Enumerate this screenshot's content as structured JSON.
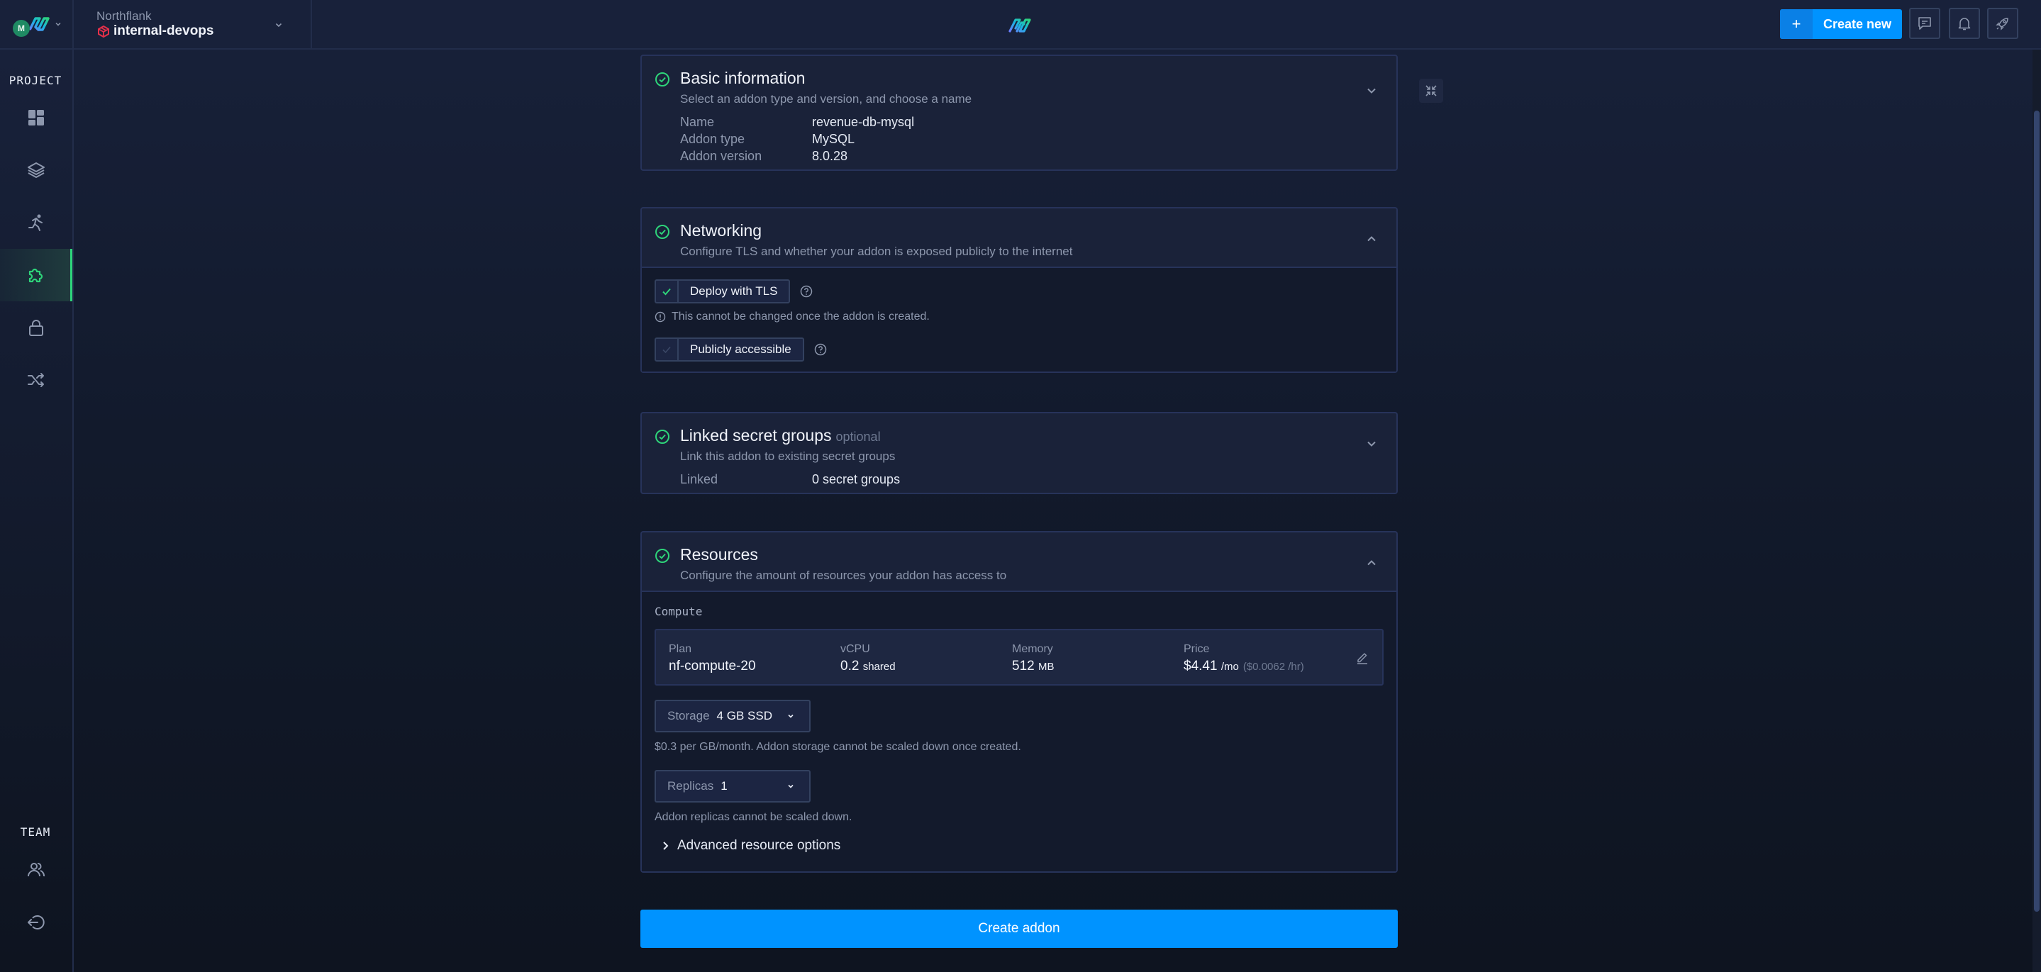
{
  "topbar": {
    "avatar_initial": "M",
    "org_name": "Northflank",
    "project_name": "internal-devops",
    "create_new_plus": "+",
    "create_new_label": "Create new",
    "icons": [
      "chat-icon",
      "bell-icon",
      "rocket-icon"
    ]
  },
  "sidebar": {
    "project_heading": "PROJECT",
    "team_heading": "TEAM",
    "project_items": [
      {
        "name": "dashboard",
        "icon": "grid-icon",
        "active": false
      },
      {
        "name": "services",
        "icon": "layers-icon",
        "active": false
      },
      {
        "name": "jobs",
        "icon": "running-icon",
        "active": false
      },
      {
        "name": "addons",
        "icon": "puzzle-icon",
        "active": true
      },
      {
        "name": "secrets",
        "icon": "lock-icon",
        "active": false
      },
      {
        "name": "pipelines",
        "icon": "shuffle-icon",
        "active": false
      }
    ],
    "team_items": [
      {
        "name": "team-members",
        "icon": "users-icon"
      },
      {
        "name": "logout",
        "icon": "logout-icon"
      }
    ]
  },
  "sections": {
    "basic": {
      "title": "Basic information",
      "subtitle": "Select an addon type and version, and choose a name",
      "fields": [
        {
          "label": "Name",
          "value": "revenue-db-mysql"
        },
        {
          "label": "Addon type",
          "value": "MySQL"
        },
        {
          "label": "Addon version",
          "value": "8.0.28"
        }
      ]
    },
    "networking": {
      "title": "Networking",
      "subtitle": "Configure TLS and whether your addon is exposed publicly to the internet",
      "tls_label": "Deploy with TLS",
      "tls_checked": true,
      "tls_note": "This cannot be changed once the addon is created.",
      "public_label": "Publicly accessible",
      "public_checked": false
    },
    "secrets": {
      "title": "Linked secret groups",
      "optional": "optional",
      "subtitle": "Link this addon to existing secret groups",
      "linked_label": "Linked",
      "linked_value": "0 secret groups"
    },
    "resources": {
      "title": "Resources",
      "subtitle": "Configure the amount of resources your addon has access to",
      "compute_heading": "Compute",
      "plan": {
        "plan_label": "Plan",
        "plan_value": "nf-compute-20",
        "vcpu_label": "vCPU",
        "vcpu_value": "0.2",
        "vcpu_unit": "shared",
        "memory_label": "Memory",
        "memory_value": "512",
        "memory_unit": "MB",
        "price_label": "Price",
        "price_value": "$4.41",
        "price_unit": "/mo",
        "price_hourly": "($0.0062 /hr)"
      },
      "storage_label": "Storage",
      "storage_value": "4 GB SSD",
      "storage_help": "$0.3 per GB/month. Addon storage cannot be scaled down once created.",
      "replicas_label": "Replicas",
      "replicas_value": "1",
      "replicas_help": "Addon replicas cannot be scaled down.",
      "advanced_label": "Advanced resource options"
    }
  },
  "create_addon_label": "Create addon",
  "colors": {
    "accent": "#0093ff",
    "success": "#2ed47a",
    "project_icon": "#e5304a",
    "background": "#18213a"
  }
}
